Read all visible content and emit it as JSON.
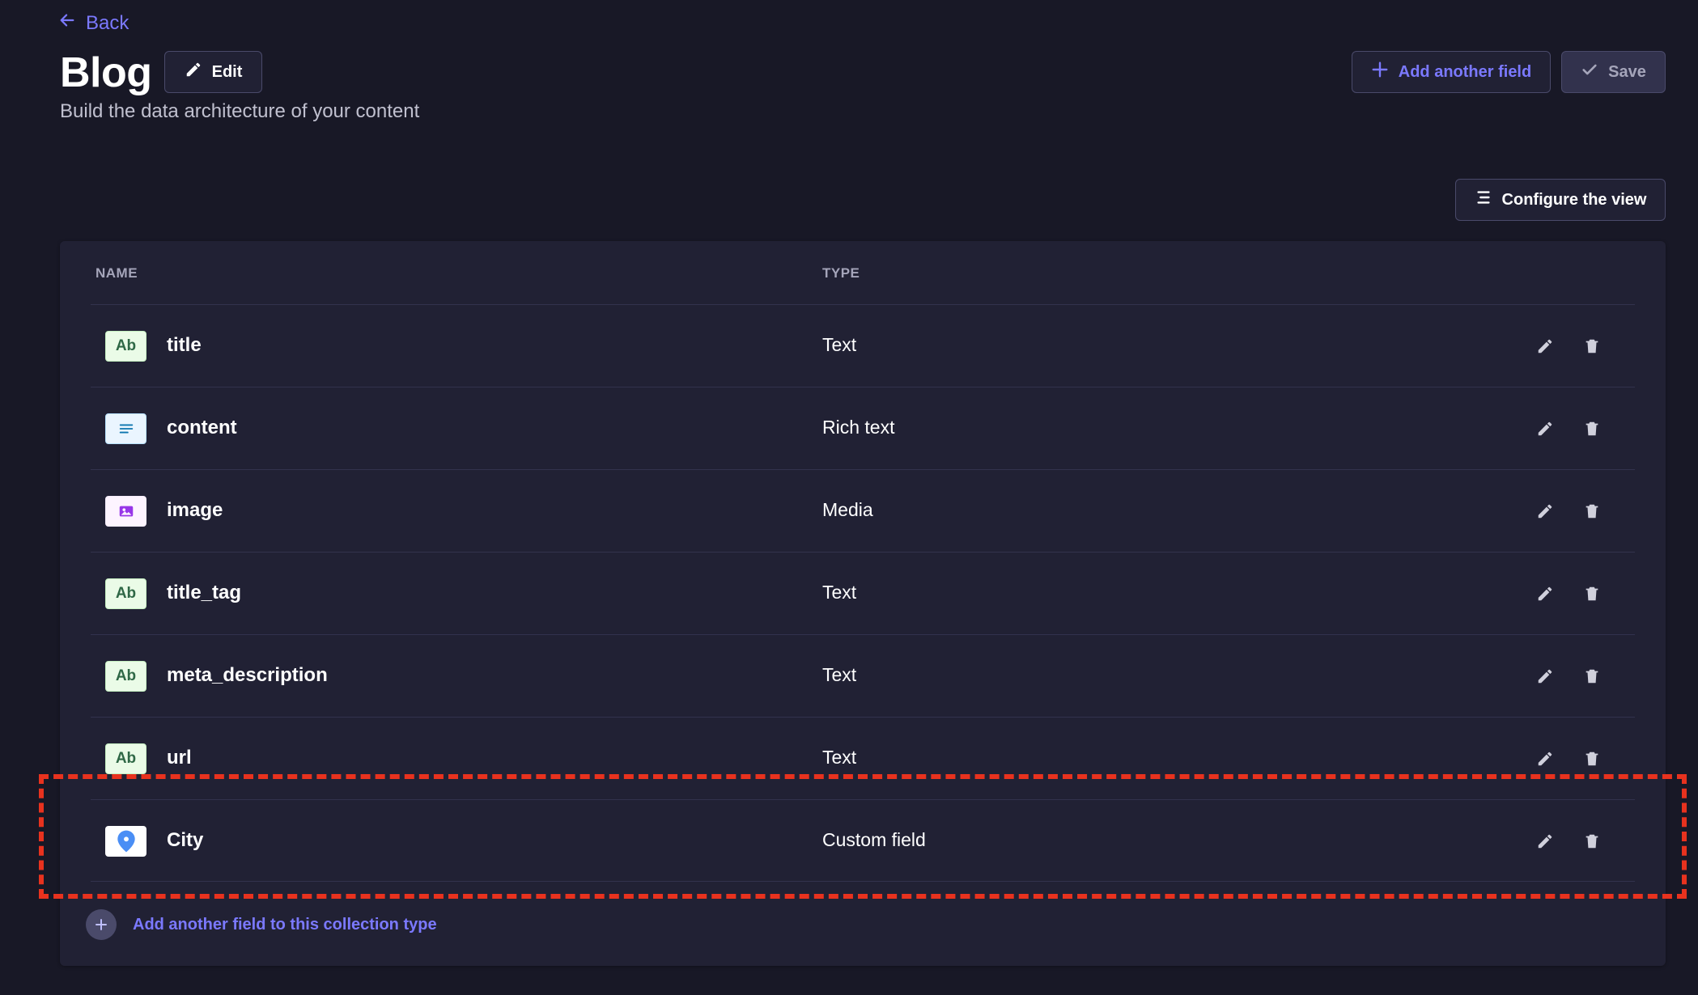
{
  "nav": {
    "back_label": "Back"
  },
  "header": {
    "title": "Blog",
    "subtitle": "Build the data architecture of your content",
    "edit_label": "Edit",
    "add_field_label": "Add another field",
    "save_label": "Save"
  },
  "toolbar": {
    "configure_label": "Configure the view"
  },
  "table": {
    "columns": {
      "name": "NAME",
      "type": "TYPE"
    },
    "rows": [
      {
        "name": "title",
        "type": "Text",
        "icon": "text-type-icon",
        "badge": "Ab"
      },
      {
        "name": "content",
        "type": "Rich text",
        "icon": "richtext-type-icon",
        "badge": ""
      },
      {
        "name": "image",
        "type": "Media",
        "icon": "media-type-icon",
        "badge": ""
      },
      {
        "name": "title_tag",
        "type": "Text",
        "icon": "text-type-icon",
        "badge": "Ab"
      },
      {
        "name": "meta_description",
        "type": "Text",
        "icon": "text-type-icon",
        "badge": "Ab"
      },
      {
        "name": "url",
        "type": "Text",
        "icon": "text-type-icon",
        "badge": "Ab"
      },
      {
        "name": "City",
        "type": "Custom field",
        "icon": "map-pin-icon",
        "badge": ""
      }
    ]
  },
  "footer": {
    "add_field_label": "Add another field to this collection type"
  },
  "colors": {
    "background": "#181826",
    "panel": "#212134",
    "accent": "#7b79ff",
    "highlight": "#e8321e"
  }
}
